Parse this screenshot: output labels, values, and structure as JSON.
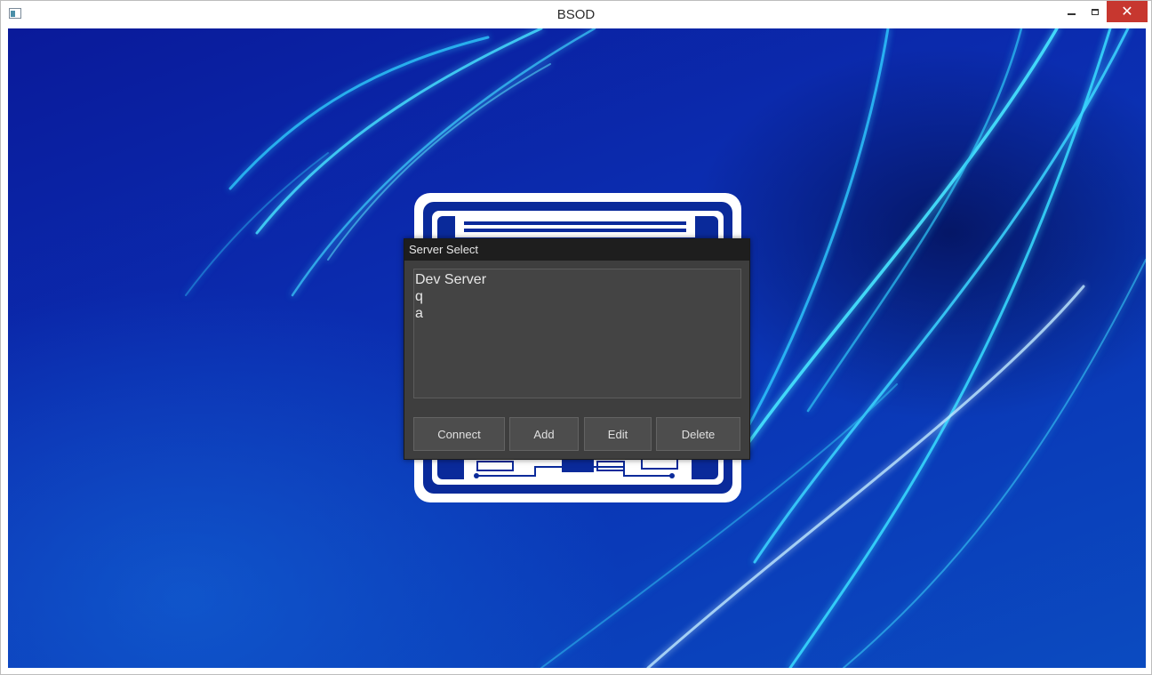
{
  "window": {
    "title": "BSOD"
  },
  "dialog": {
    "title": "Server Select",
    "servers": [
      "Dev Server",
      "q",
      "a"
    ],
    "buttons": {
      "connect": "Connect",
      "add": "Add",
      "edit": "Edit",
      "delete": "Delete"
    }
  },
  "colors": {
    "background_primary": "#0b2db0",
    "swirl_highlight": "#41e6ff",
    "dialog_bg": "#3e3e3e",
    "dialog_title_bg": "#1e1e1e",
    "close_button": "#c7372f"
  }
}
